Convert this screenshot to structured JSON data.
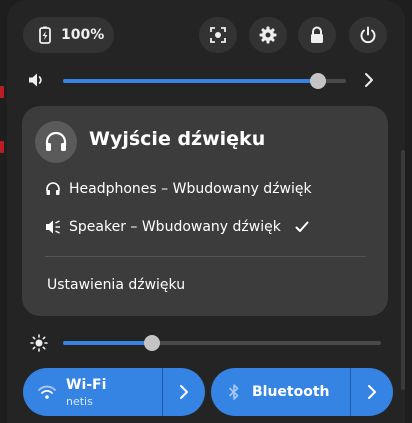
{
  "status_bar": {
    "battery_percent": "100%"
  },
  "volume": {
    "level": 0.9
  },
  "sound_output_menu": {
    "title": "Wyjście dźwięku",
    "devices": [
      {
        "label": "Headphones – Wbudowany dźwięk",
        "icon": "headphones-icon",
        "selected": false
      },
      {
        "label": "Speaker – Wbudowany dźwięk",
        "icon": "speaker-icon",
        "selected": true
      }
    ],
    "settings_label": "Ustawienia dźwięku"
  },
  "brightness": {
    "level": 0.28
  },
  "toggles": {
    "wifi": {
      "label": "Wi-Fi",
      "sublabel": "netis",
      "active": true
    },
    "bluetooth": {
      "label": "Bluetooth",
      "active": true
    }
  },
  "colors": {
    "accent": "#3584e4",
    "panel": "#242424",
    "menu": "#3c3c3c",
    "alert_edge": "#c01c28"
  }
}
